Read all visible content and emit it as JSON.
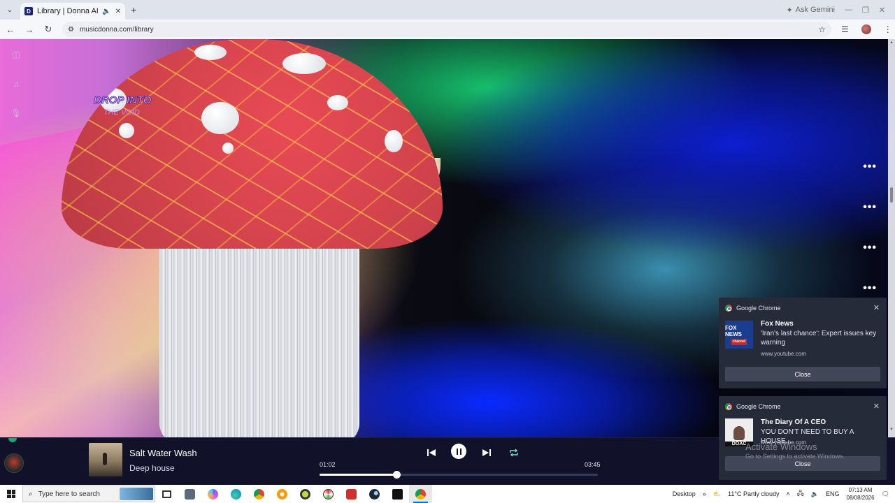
{
  "browser": {
    "tab_title": "Library | Donna AI",
    "tab_favicon": "D",
    "url": "musicdonna.com/library",
    "gemini_label": "Ask Gemini"
  },
  "hero": {
    "logo_line1": "DROP INTO",
    "logo_line2": "THE VOID"
  },
  "player": {
    "song_title": "Salt Water Wash",
    "artist": "Deep house",
    "elapsed": "01:02",
    "duration": "03:45",
    "progress": 0.2756
  },
  "notifications": [
    {
      "app": "Google Chrome",
      "title": "Fox News",
      "body": "'Iran's last chance': Expert issues key warning",
      "source": "www.youtube.com",
      "button": "Close",
      "thumb_text": "FOX NEWS",
      "thumb_sub": "channel"
    },
    {
      "app": "Google Chrome",
      "title": "The Diary Of A CEO",
      "body": "YOU DON'T NEED TO BUY A HOUSE...",
      "source": "www.youtube.com",
      "button": "Close",
      "thumb_text": "DOAC"
    }
  ],
  "windows_watermark": {
    "line1": "Activate Windows",
    "line2": "Go to Settings to activate Windows."
  },
  "taskbar": {
    "search_placeholder": "Type here to search",
    "desktop_label": "Desktop",
    "weather": "11°C Partly cloudy",
    "language": "ENG",
    "time": "07:13 AM",
    "date": "08/08/2026"
  },
  "more_menu_glyph": "•••",
  "colors": {
    "player_bg": "#11122a",
    "notification_bg": "#262b3a",
    "mushroom_cap": "#d8454e"
  }
}
